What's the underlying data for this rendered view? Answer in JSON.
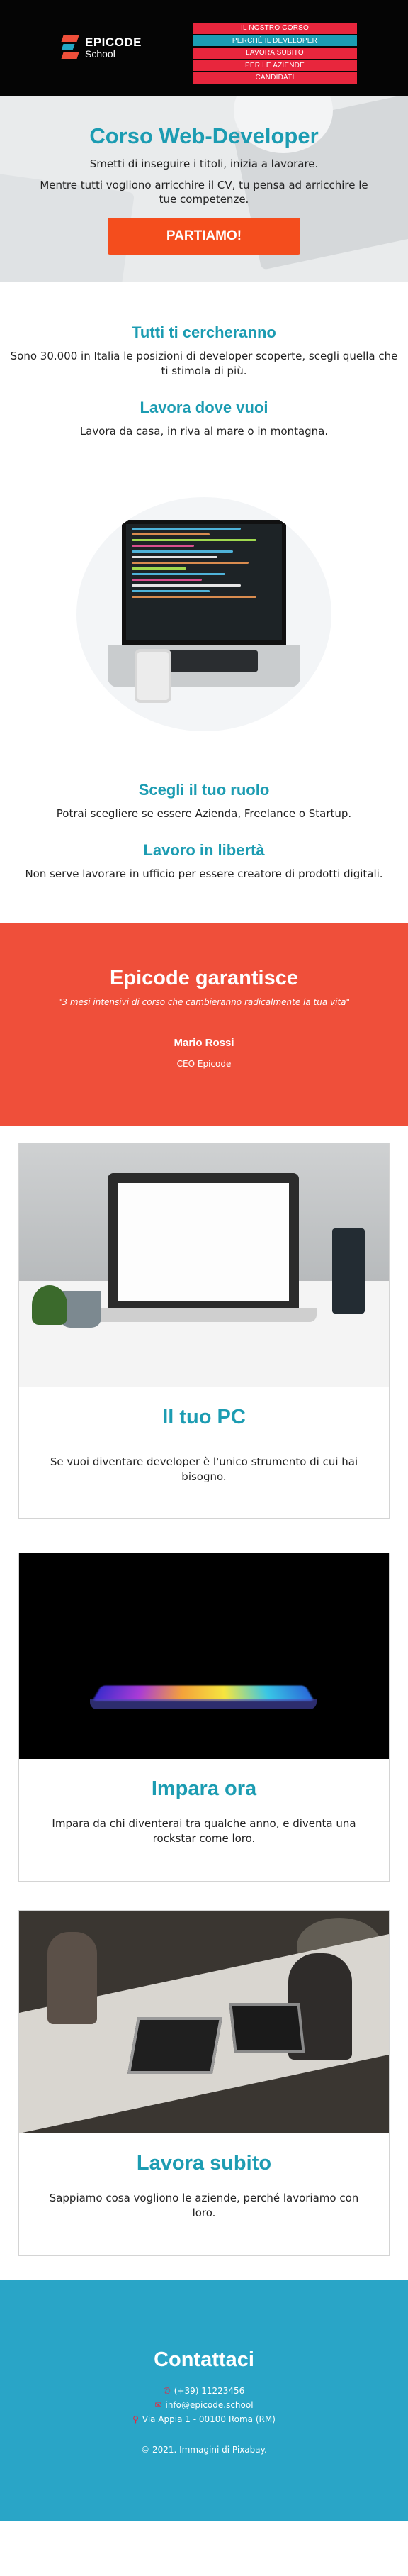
{
  "header": {
    "logo_title": "EPICODE",
    "logo_sub": "School",
    "nav": [
      {
        "label": "IL NOSTRO CORSO",
        "color": "#e8263d"
      },
      {
        "label": "PERCHÉ IL DEVELOPER",
        "color": "#1c9cb2"
      },
      {
        "label": "LAVORA SUBITO",
        "color": "#e8263d"
      },
      {
        "label": "PER LE AZIENDE",
        "color": "#e8263d"
      },
      {
        "label": "CANDIDATI",
        "color": "#e8263d"
      }
    ]
  },
  "hero": {
    "title": "Corso Web-Developer",
    "line1": "Smetti di inseguire i titoli, inizia a lavorare.",
    "line2": "Mentre tutti vogliono arricchire il CV, tu pensa ad arricchire le tue competenze.",
    "cta": "PARTIAMO!"
  },
  "features": [
    {
      "title": "Tutti ti cercheranno",
      "text": "Sono 30.000 in Italia le posizioni di developer scoperte, scegli quella che ti stimola di più."
    },
    {
      "title": "Lavora dove vuoi",
      "text": "Lavora da casa, in riva al mare o in montagna."
    },
    {
      "title": "Scegli il tuo ruolo",
      "text": "Potrai scegliere se essere Azienda, Freelance o Startup."
    },
    {
      "title": "Lavoro in libertà",
      "text": "Non serve lavorare in ufficio per essere creatore di prodotti digitali."
    }
  ],
  "guarantee": {
    "title": "Epicode garantisce",
    "quote": "\"3 mesi intensivi di corso che cambieranno radicalmente la tua vita\"",
    "name": "Mario Rossi",
    "role": "CEO Epicode"
  },
  "cards": [
    {
      "title": "Il tuo PC",
      "text": "Se vuoi diventare developer è l'unico strumento di cui hai bisogno."
    },
    {
      "title": "Impara ora",
      "text": "Impara da chi diventerai tra qualche anno, e diventa una rockstar come loro."
    },
    {
      "title": "Lavora subito",
      "text": "Sappiamo cosa vogliono le aziende, perché lavoriamo con loro."
    }
  ],
  "contact": {
    "title": "Contattaci",
    "phone": "(+39) 11223456",
    "email": "info@epicode.school",
    "address": "Via Appia 1 - 00100 Roma (RM)",
    "copyright": "© 2021. Immagini di Pixabay."
  },
  "colors": {
    "teal": "#1c9cb2",
    "red": "#e8263d",
    "orange": "#f44d1d",
    "guarantee_bg": "#ef4f3a",
    "contact_bg": "#29a5c7"
  },
  "icons": [
    "phone-icon",
    "envelope-icon",
    "map-pin-icon"
  ]
}
